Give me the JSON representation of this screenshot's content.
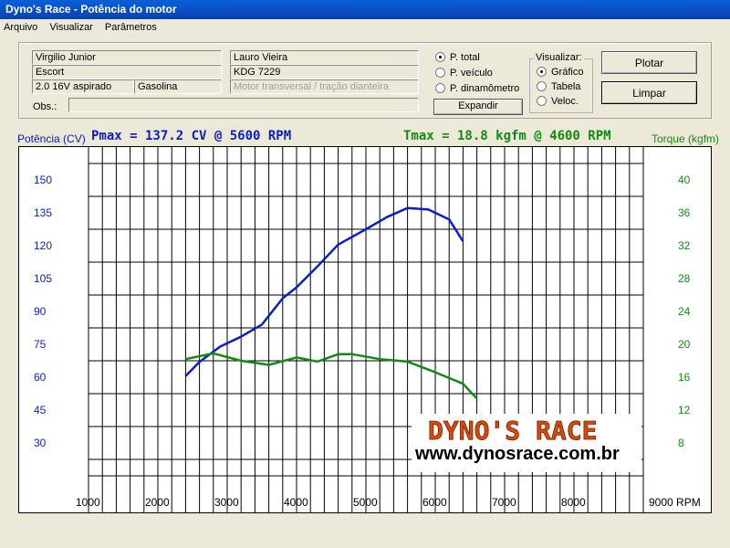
{
  "window": {
    "title": "Dyno's Race - Potência do motor"
  },
  "menu": [
    "Arquivo",
    "Visualizar",
    "Parâmetros"
  ],
  "info": {
    "client": "Virgilio Junior",
    "vehicle": "Escort",
    "engine": "2.0 16V aspirado",
    "fuel": "Gasolina",
    "operator": "Lauro Vieira",
    "plate": "KDG 7229",
    "layout": "Motor transversal / tração dianteira",
    "obs_label": "Obs.:",
    "obs_value": ""
  },
  "power_mode": {
    "options": [
      "P. total",
      "P. veículo",
      "P. dinamômetro"
    ],
    "selected": 0
  },
  "expand_button": "Expandir",
  "view": {
    "label": "Visualizar:",
    "options": [
      "Gráfico",
      "Tabela",
      "Veloc."
    ],
    "selected": 0
  },
  "buttons": {
    "plot": "Plotar",
    "clear": "Limpar"
  },
  "colors": {
    "power": "#0a1ec8",
    "torque": "#138a13",
    "chart_bg": "#ffffff",
    "grid": "#000000"
  },
  "watermark": {
    "logo": "DYNO'S RACE",
    "url": "www.dynosrace.com.br"
  },
  "chart_data": {
    "type": "line",
    "title_left": "Pmax = 137.2 CV @ 5600 RPM",
    "title_right": "Tmax = 18.8 kgfm @ 4600 RPM",
    "ylabel_left": "Potência (CV)",
    "ylabel_right": "Torque (kgfm)",
    "xunit": "RPM",
    "xlim": [
      0,
      9000
    ],
    "ylim_left": [
      15,
      165
    ],
    "ylim_right": [
      4,
      44
    ],
    "x_ticks": [
      1000,
      2000,
      3000,
      4000,
      5000,
      6000,
      7000,
      8000,
      9000
    ],
    "y_ticks_left": [
      150,
      135,
      120,
      105,
      90,
      75,
      60,
      45,
      30
    ],
    "y_ticks_right": [
      40,
      36,
      32,
      28,
      24,
      20,
      16,
      12,
      8
    ],
    "series": [
      {
        "axis": "left",
        "x": [
          2400,
          2600,
          2900,
          3200,
          3500,
          3800,
          4000,
          4300,
          4600,
          5000,
          5300,
          5600,
          5900,
          6200,
          6400
        ],
        "values": [
          60.5,
          67,
          74,
          78.5,
          84,
          96,
          101,
          110.5,
          120.5,
          127.5,
          133,
          137.2,
          136.5,
          132,
          122
        ]
      },
      {
        "axis": "right",
        "x": [
          2400,
          2800,
          3200,
          3600,
          4000,
          4300,
          4600,
          4800,
          5200,
          5600,
          6000,
          6400,
          6600
        ],
        "values": [
          18.2,
          18.9,
          18.0,
          17.5,
          18.4,
          17.9,
          18.8,
          18.8,
          18.2,
          17.9,
          16.6,
          15.2,
          13.4
        ]
      }
    ]
  }
}
